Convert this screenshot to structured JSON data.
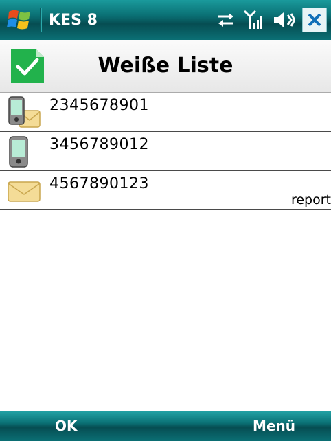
{
  "statusbar": {
    "app_title": "KES 8",
    "icons": [
      "windows-start-icon",
      "sync-icon",
      "signal-icon",
      "speaker-icon",
      "close-icon"
    ]
  },
  "header": {
    "title": "Weiße Liste",
    "icon": "checkmark-document-icon"
  },
  "list": {
    "items": [
      {
        "number": "2345678901",
        "icon": "phone-and-mail-icon",
        "tag": ""
      },
      {
        "number": "3456789012",
        "icon": "phone-icon",
        "tag": ""
      },
      {
        "number": "4567890123",
        "icon": "mail-icon",
        "tag": "report"
      }
    ]
  },
  "softkeys": {
    "left": "OK",
    "right": "Menü"
  },
  "colors": {
    "statusbar": "#0a6f73",
    "header_bg": "#efefef",
    "accent_green": "#22b24c",
    "divider": "#4a4a4a"
  }
}
